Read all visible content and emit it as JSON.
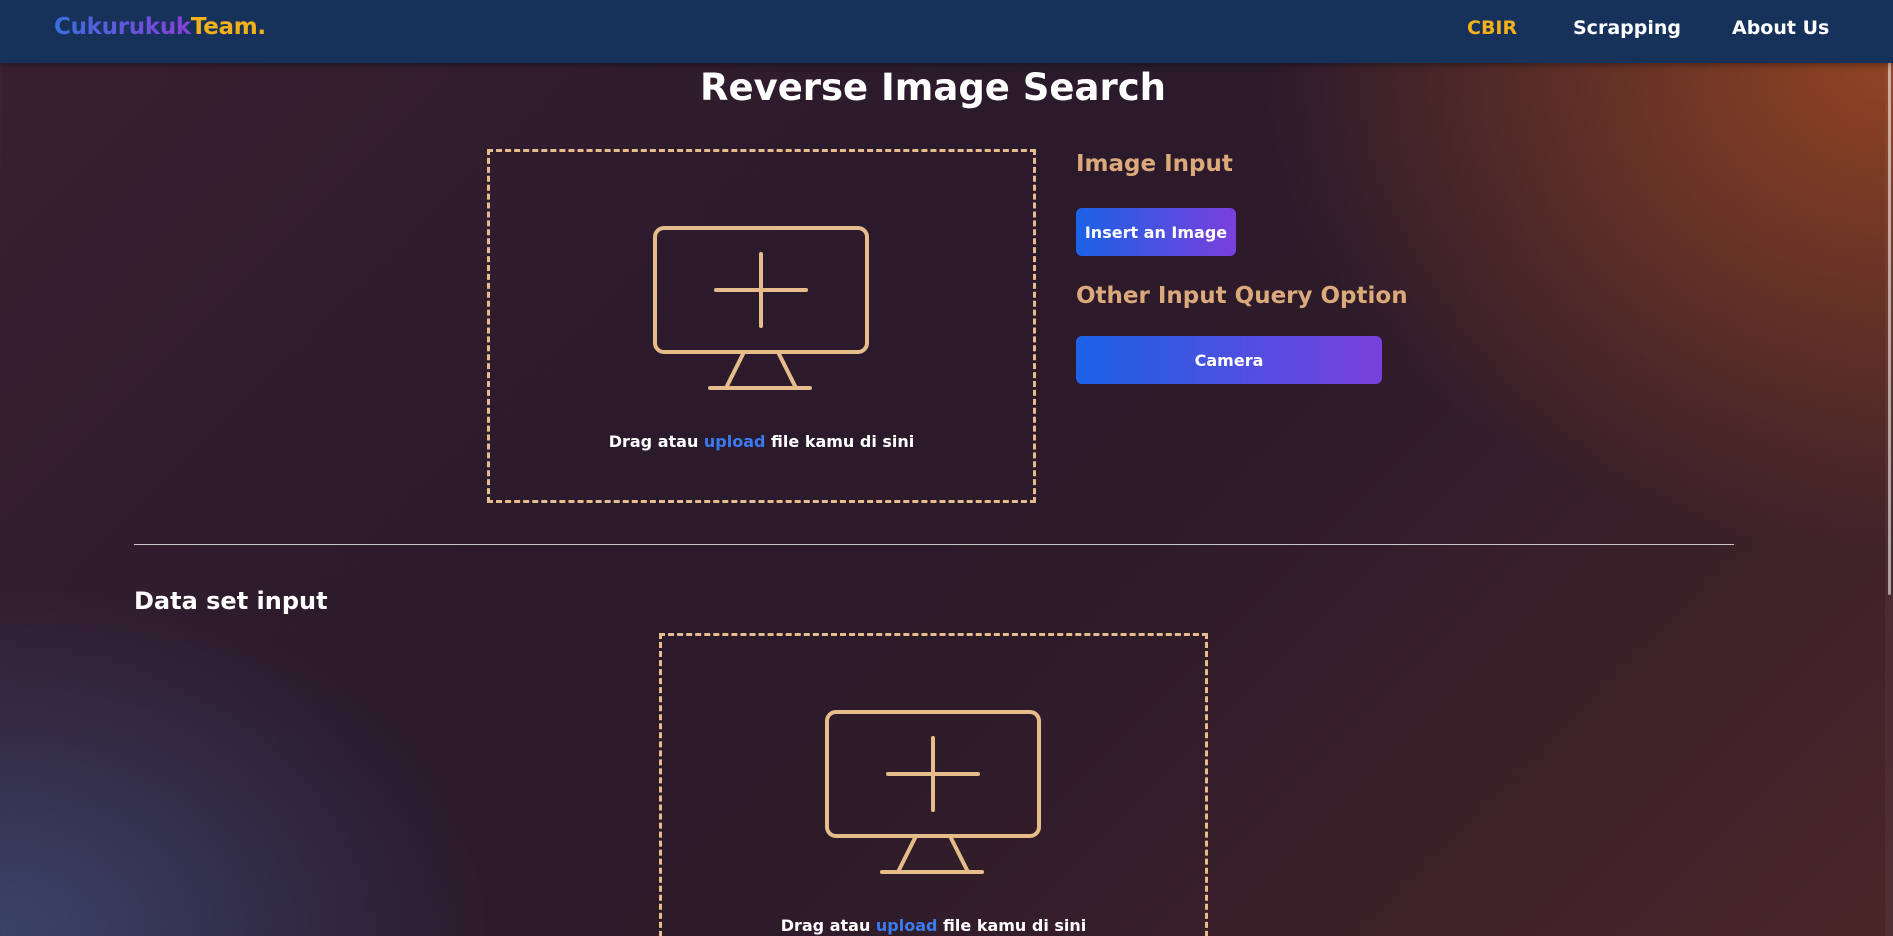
{
  "navbar": {
    "logo_part1": "Cukurukuk",
    "logo_part2": "Team.",
    "items": [
      {
        "label": "CBIR",
        "active": true
      },
      {
        "label": "Scrapping",
        "active": false
      },
      {
        "label": "About Us",
        "active": false
      }
    ]
  },
  "main": {
    "title": "Reverse Image Search",
    "image_dropzone": {
      "text_before": "Drag atau ",
      "link": "upload",
      "text_after": " file kamu di sini",
      "icon": "monitor-plus-icon"
    },
    "image_input_heading": "Image Input",
    "insert_button": "Insert an Image",
    "other_option_heading": "Other Input Query Option",
    "camera_button": "Camera"
  },
  "dataset": {
    "title": "Data set input",
    "dropzone": {
      "text_before": "Drag atau ",
      "link": "upload",
      "text_after": " file kamu di sini",
      "icon": "monitor-plus-icon"
    }
  },
  "colors": {
    "navbar_bg": "#17325a",
    "accent_yellow": "#f5b11a",
    "dropzone_border": "#e6bd8a",
    "heading_tan": "#dba97a",
    "link_blue": "#3b7bf0",
    "button_gradient_start": "#1b62e6",
    "button_gradient_end": "#7a3fdc"
  }
}
